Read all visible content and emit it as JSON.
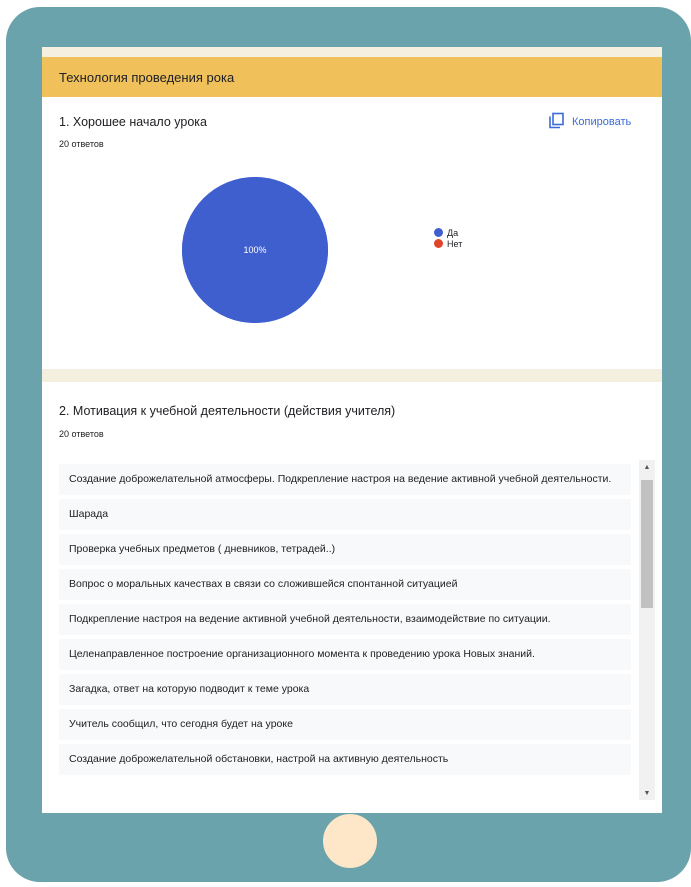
{
  "section_title": "Технология проведения рока",
  "question1": {
    "title": "1. Хорошее начало урока",
    "count": "20 ответов",
    "copy_label": "Копировать",
    "pie_label": "100%",
    "legend": [
      {
        "label": "Да",
        "color": "#3f5fcf"
      },
      {
        "label": "Нет",
        "color": "#e0442b"
      }
    ]
  },
  "chart_data": {
    "type": "pie",
    "categories": [
      "Да",
      "Нет"
    ],
    "values": [
      100,
      0
    ],
    "legend_position": "right"
  },
  "question2": {
    "title": "2. Мотивация к учебной деятельности (действия учителя)",
    "count": "20 ответов",
    "responses": [
      "Создание доброжелательной атмосферы. Подкрепление настроя на ведение активной учебной деятельности.",
      "Шарада",
      "Проверка учебных предметов ( дневников, тетрадей..)",
      "Вопрос о моральных качествах в связи со сложившейся спонтанной ситуацией",
      "Подкрепление настроя на ведение активной учебной деятельности, взаимодействие по ситуации.",
      "Целенаправленное построение организационного момента к проведению урока Новых знаний.",
      "Загадка, ответ на которую подводит к теме урока",
      "Учитель сообщил, что сегодня будет на уроке",
      "Создание доброжелательной обстановки, настрой на активную деятельность"
    ]
  }
}
